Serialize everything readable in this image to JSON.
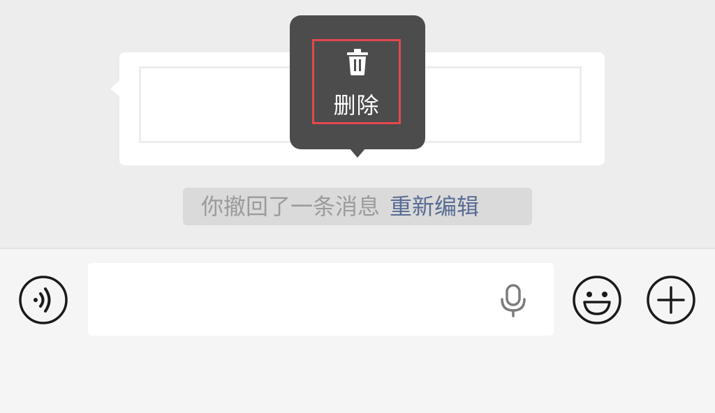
{
  "context_menu": {
    "delete_label": "删除",
    "delete_icon": "trash-icon",
    "highlight_color": "#e5484d"
  },
  "recall_notice": {
    "text": "你撤回了一条消息",
    "reedit_label": "重新编辑",
    "link_color": "#586c94"
  },
  "input_bar": {
    "text_value": "",
    "voice_toggle_icon": "voice-mode-icon",
    "mic_icon": "microphone-icon",
    "emoji_icon": "emoji-icon",
    "more_icon": "plus-icon"
  }
}
